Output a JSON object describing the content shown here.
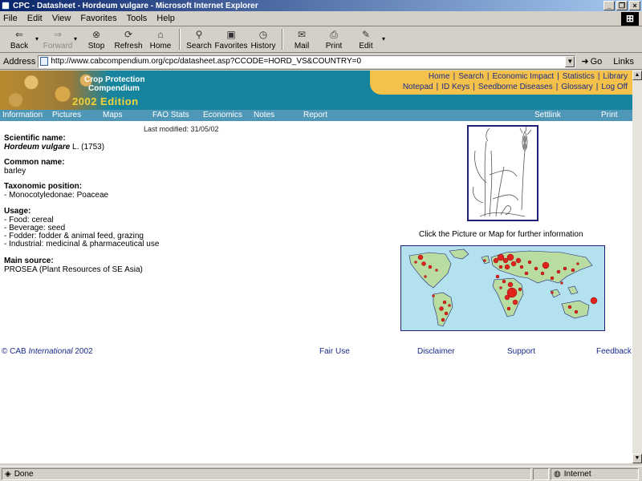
{
  "window": {
    "title": "CPC - Datasheet - Hordeum vulgare - Microsoft Internet Explorer",
    "minimize": "_",
    "maximize": "❐",
    "close": "×"
  },
  "menu": [
    "File",
    "Edit",
    "View",
    "Favorites",
    "Tools",
    "Help"
  ],
  "toolbar": {
    "back": "Back",
    "forward": "Forward",
    "stop": "Stop",
    "refresh": "Refresh",
    "home": "Home",
    "search": "Search",
    "favorites": "Favorites",
    "history": "History",
    "mail": "Mail",
    "print": "Print",
    "edit": "Edit"
  },
  "address": {
    "label": "Address",
    "url": "http://www.cabcompendium.org/cpc/datasheet.asp?CCODE=HORD_VS&COUNTRY=0",
    "go": "Go",
    "links": "Links"
  },
  "banner": {
    "line1": "Crop Protection",
    "line2": "Compendium",
    "edition": "2002 Edition",
    "nav_row1": [
      "Home",
      "Search",
      "Economic Impact",
      "Statistics",
      "Library"
    ],
    "nav_row2": [
      "Notepad",
      "ID Keys",
      "Seedborne Diseases",
      "Glossary",
      "Log Off"
    ]
  },
  "subnav": [
    "Information",
    "Pictures",
    "Maps",
    "FAO Stats",
    "Economics",
    "Notes",
    "Report",
    "Settlink",
    "Print"
  ],
  "content": {
    "last_modified": "Last modified: 31/05/02",
    "scientific_label": "Scientific name:",
    "scientific_name": "Hordeum vulgare",
    "scientific_author": "L. (1753)",
    "common_label": "Common name:",
    "common_value": "barley",
    "taxo_label": "Taxonomic position:",
    "taxo_value": "- Monocotyledonae: Poaceae",
    "usage_label": "Usage:",
    "usage_items": [
      "- Food: cereal",
      "- Beverage: seed",
      "- Fodder: fodder & animal feed, grazing",
      "- Industrial: medicinal & pharmaceutical use"
    ],
    "source_label": "Main source:",
    "source_value": "PROSEA (Plant Resources of SE Asia)",
    "caption": "Click the Picture or Map for further information"
  },
  "footer": {
    "copyright_prefix": "© CAB ",
    "copyright_italic": "International",
    "copyright_year": " 2002",
    "fair_use": "Fair Use",
    "disclaimer": "Disclaimer",
    "support": "Support",
    "feedback": "Feedback"
  },
  "status": {
    "left": "Done",
    "zone": "Internet"
  }
}
